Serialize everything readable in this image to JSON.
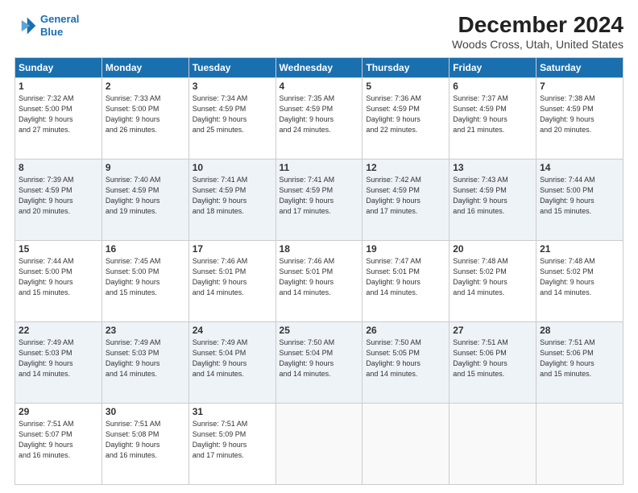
{
  "logo": {
    "line1": "General",
    "line2": "Blue"
  },
  "header": {
    "title": "December 2024",
    "subtitle": "Woods Cross, Utah, United States"
  },
  "weekdays": [
    "Sunday",
    "Monday",
    "Tuesday",
    "Wednesday",
    "Thursday",
    "Friday",
    "Saturday"
  ],
  "weeks": [
    [
      {
        "day": "1",
        "info": "Sunrise: 7:32 AM\nSunset: 5:00 PM\nDaylight: 9 hours\nand 27 minutes."
      },
      {
        "day": "2",
        "info": "Sunrise: 7:33 AM\nSunset: 5:00 PM\nDaylight: 9 hours\nand 26 minutes."
      },
      {
        "day": "3",
        "info": "Sunrise: 7:34 AM\nSunset: 4:59 PM\nDaylight: 9 hours\nand 25 minutes."
      },
      {
        "day": "4",
        "info": "Sunrise: 7:35 AM\nSunset: 4:59 PM\nDaylight: 9 hours\nand 24 minutes."
      },
      {
        "day": "5",
        "info": "Sunrise: 7:36 AM\nSunset: 4:59 PM\nDaylight: 9 hours\nand 22 minutes."
      },
      {
        "day": "6",
        "info": "Sunrise: 7:37 AM\nSunset: 4:59 PM\nDaylight: 9 hours\nand 21 minutes."
      },
      {
        "day": "7",
        "info": "Sunrise: 7:38 AM\nSunset: 4:59 PM\nDaylight: 9 hours\nand 20 minutes."
      }
    ],
    [
      {
        "day": "8",
        "info": "Sunrise: 7:39 AM\nSunset: 4:59 PM\nDaylight: 9 hours\nand 20 minutes."
      },
      {
        "day": "9",
        "info": "Sunrise: 7:40 AM\nSunset: 4:59 PM\nDaylight: 9 hours\nand 19 minutes."
      },
      {
        "day": "10",
        "info": "Sunrise: 7:41 AM\nSunset: 4:59 PM\nDaylight: 9 hours\nand 18 minutes."
      },
      {
        "day": "11",
        "info": "Sunrise: 7:41 AM\nSunset: 4:59 PM\nDaylight: 9 hours\nand 17 minutes."
      },
      {
        "day": "12",
        "info": "Sunrise: 7:42 AM\nSunset: 4:59 PM\nDaylight: 9 hours\nand 17 minutes."
      },
      {
        "day": "13",
        "info": "Sunrise: 7:43 AM\nSunset: 4:59 PM\nDaylight: 9 hours\nand 16 minutes."
      },
      {
        "day": "14",
        "info": "Sunrise: 7:44 AM\nSunset: 5:00 PM\nDaylight: 9 hours\nand 15 minutes."
      }
    ],
    [
      {
        "day": "15",
        "info": "Sunrise: 7:44 AM\nSunset: 5:00 PM\nDaylight: 9 hours\nand 15 minutes."
      },
      {
        "day": "16",
        "info": "Sunrise: 7:45 AM\nSunset: 5:00 PM\nDaylight: 9 hours\nand 15 minutes."
      },
      {
        "day": "17",
        "info": "Sunrise: 7:46 AM\nSunset: 5:01 PM\nDaylight: 9 hours\nand 14 minutes."
      },
      {
        "day": "18",
        "info": "Sunrise: 7:46 AM\nSunset: 5:01 PM\nDaylight: 9 hours\nand 14 minutes."
      },
      {
        "day": "19",
        "info": "Sunrise: 7:47 AM\nSunset: 5:01 PM\nDaylight: 9 hours\nand 14 minutes."
      },
      {
        "day": "20",
        "info": "Sunrise: 7:48 AM\nSunset: 5:02 PM\nDaylight: 9 hours\nand 14 minutes."
      },
      {
        "day": "21",
        "info": "Sunrise: 7:48 AM\nSunset: 5:02 PM\nDaylight: 9 hours\nand 14 minutes."
      }
    ],
    [
      {
        "day": "22",
        "info": "Sunrise: 7:49 AM\nSunset: 5:03 PM\nDaylight: 9 hours\nand 14 minutes."
      },
      {
        "day": "23",
        "info": "Sunrise: 7:49 AM\nSunset: 5:03 PM\nDaylight: 9 hours\nand 14 minutes."
      },
      {
        "day": "24",
        "info": "Sunrise: 7:49 AM\nSunset: 5:04 PM\nDaylight: 9 hours\nand 14 minutes."
      },
      {
        "day": "25",
        "info": "Sunrise: 7:50 AM\nSunset: 5:04 PM\nDaylight: 9 hours\nand 14 minutes."
      },
      {
        "day": "26",
        "info": "Sunrise: 7:50 AM\nSunset: 5:05 PM\nDaylight: 9 hours\nand 14 minutes."
      },
      {
        "day": "27",
        "info": "Sunrise: 7:51 AM\nSunset: 5:06 PM\nDaylight: 9 hours\nand 15 minutes."
      },
      {
        "day": "28",
        "info": "Sunrise: 7:51 AM\nSunset: 5:06 PM\nDaylight: 9 hours\nand 15 minutes."
      }
    ],
    [
      {
        "day": "29",
        "info": "Sunrise: 7:51 AM\nSunset: 5:07 PM\nDaylight: 9 hours\nand 16 minutes."
      },
      {
        "day": "30",
        "info": "Sunrise: 7:51 AM\nSunset: 5:08 PM\nDaylight: 9 hours\nand 16 minutes."
      },
      {
        "day": "31",
        "info": "Sunrise: 7:51 AM\nSunset: 5:09 PM\nDaylight: 9 hours\nand 17 minutes."
      },
      {
        "day": "",
        "info": ""
      },
      {
        "day": "",
        "info": ""
      },
      {
        "day": "",
        "info": ""
      },
      {
        "day": "",
        "info": ""
      }
    ]
  ]
}
